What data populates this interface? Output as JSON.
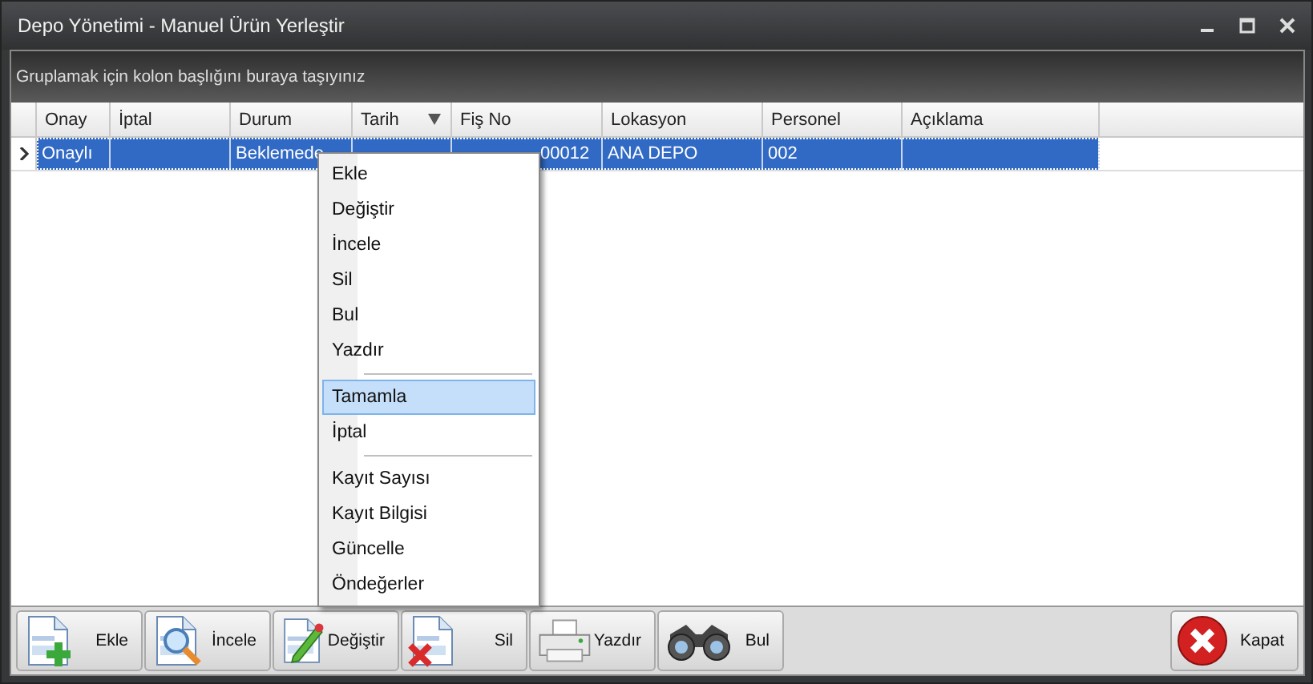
{
  "window": {
    "title": "Depo Yönetimi - Manuel Ürün Yerleştir"
  },
  "group_panel": {
    "hint": "Gruplamak için kolon başlığını buraya taşıyınız"
  },
  "table": {
    "columns": [
      {
        "label": "Onay",
        "sorted": false
      },
      {
        "label": "İptal",
        "sorted": false
      },
      {
        "label": "Durum",
        "sorted": false
      },
      {
        "label": "Tarih",
        "sorted": true
      },
      {
        "label": "Fiş No",
        "sorted": false
      },
      {
        "label": "Lokasyon",
        "sorted": false
      },
      {
        "label": "Personel",
        "sorted": false
      },
      {
        "label": "Açıklama",
        "sorted": false
      }
    ],
    "rows": [
      {
        "selected": true,
        "cells": [
          "Onaylı",
          "",
          "Beklemede",
          "",
          "00012",
          "ANA DEPO",
          "002",
          ""
        ]
      }
    ]
  },
  "context_menu": {
    "items": [
      {
        "kind": "item",
        "label": "Ekle",
        "selected": false
      },
      {
        "kind": "item",
        "label": "Değiştir",
        "selected": false
      },
      {
        "kind": "item",
        "label": "İncele",
        "selected": false
      },
      {
        "kind": "item",
        "label": "Sil",
        "selected": false
      },
      {
        "kind": "item",
        "label": "Bul",
        "selected": false
      },
      {
        "kind": "item",
        "label": "Yazdır",
        "selected": false
      },
      {
        "kind": "separator"
      },
      {
        "kind": "item",
        "label": "Tamamla",
        "selected": true
      },
      {
        "kind": "item",
        "label": "İptal",
        "selected": false
      },
      {
        "kind": "separator"
      },
      {
        "kind": "item",
        "label": "Kayıt Sayısı",
        "selected": false
      },
      {
        "kind": "item",
        "label": "Kayıt Bilgisi",
        "selected": false
      },
      {
        "kind": "item",
        "label": "Güncelle",
        "selected": false
      },
      {
        "kind": "item",
        "label": "Öndeğerler",
        "selected": false
      }
    ]
  },
  "toolbar": [
    {
      "kind": "add",
      "label": "Ekle"
    },
    {
      "kind": "view",
      "label": "İncele"
    },
    {
      "kind": "edit",
      "label": "Değiştir"
    },
    {
      "kind": "delete",
      "label": "Sil"
    },
    {
      "kind": "print",
      "label": "Yazdır"
    },
    {
      "kind": "find",
      "label": "Bul"
    }
  ],
  "close_button": {
    "label": "Kapat"
  }
}
